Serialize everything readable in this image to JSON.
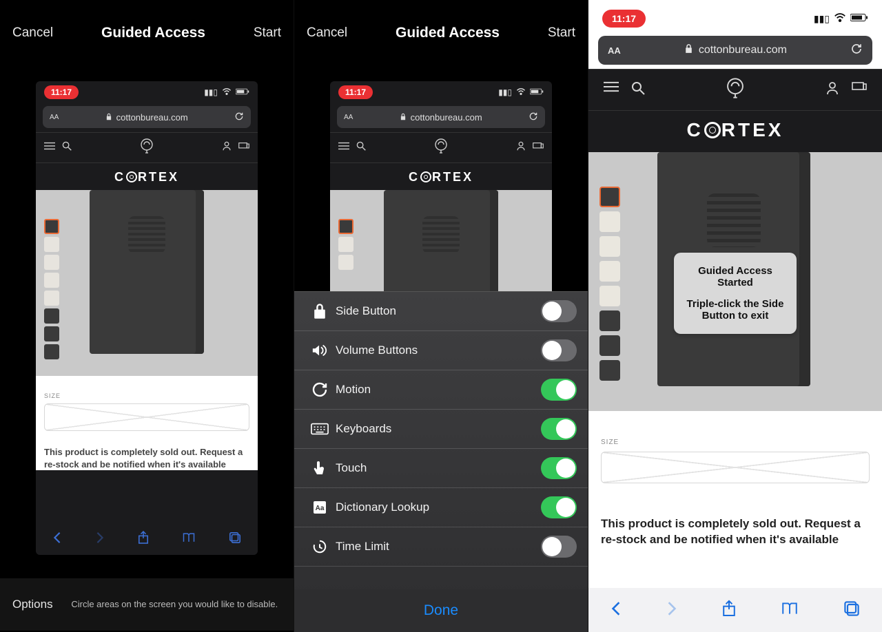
{
  "panel1": {
    "cancel": "Cancel",
    "title": "Guided Access",
    "start": "Start",
    "options_label": "Options",
    "hint": "Circle areas on the screen you would like to disable."
  },
  "panel2": {
    "cancel": "Cancel",
    "title": "Guided Access",
    "start": "Start",
    "done": "Done",
    "options": [
      {
        "icon": "lock-icon",
        "label": "Side Button",
        "on": false
      },
      {
        "icon": "volume-icon",
        "label": "Volume Buttons",
        "on": false
      },
      {
        "icon": "motion-icon",
        "label": "Motion",
        "on": true
      },
      {
        "icon": "keyboard-icon",
        "label": "Keyboards",
        "on": true
      },
      {
        "icon": "touch-icon",
        "label": "Touch",
        "on": true
      },
      {
        "icon": "dictionary-icon",
        "label": "Dictionary Lookup",
        "on": true
      },
      {
        "icon": "timelimit-icon",
        "label": "Time Limit",
        "on": false
      }
    ]
  },
  "panel3": {
    "alert_title": "Guided Access Started",
    "alert_sub": "Triple-click the Side Button to exit"
  },
  "phone": {
    "time": "11:17",
    "url": "cottonbureau.com",
    "brand": "CORTEX",
    "size_label": "SIZE",
    "soldout": "This product is completely sold out. Request a re-stock and be notified when it's available"
  }
}
